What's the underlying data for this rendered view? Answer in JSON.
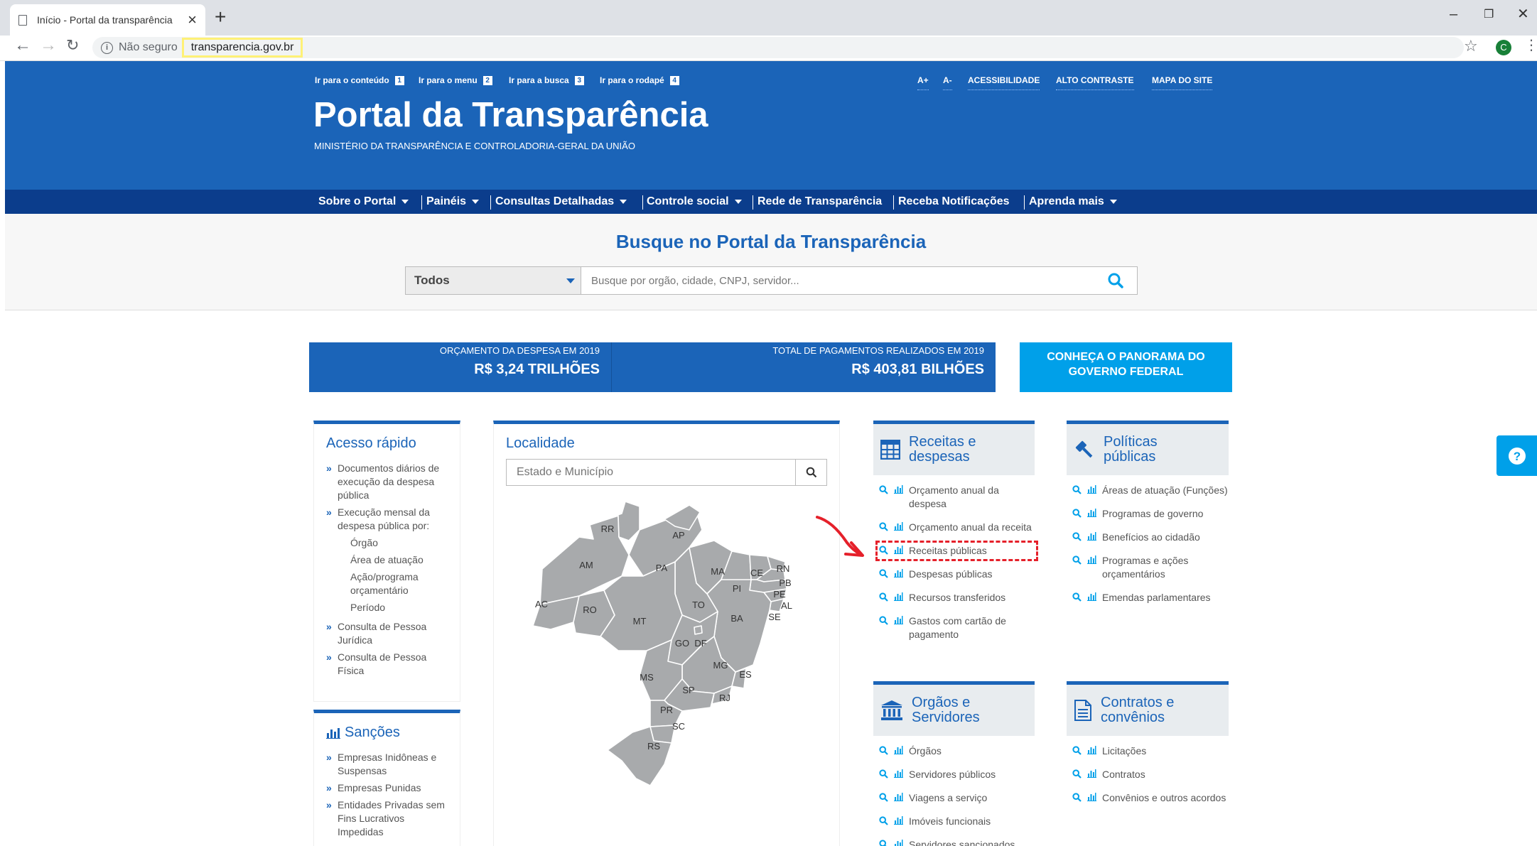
{
  "browser": {
    "tab_title": "Início - Portal da transparência",
    "insecure_label": "Não seguro",
    "url": "transparencia.gov.br",
    "avatar_letter": "C"
  },
  "header": {
    "skip_links": [
      {
        "label": "Ir para o conteúdo",
        "num": "1"
      },
      {
        "label": "Ir para o menu",
        "num": "2"
      },
      {
        "label": "Ir para a busca",
        "num": "3"
      },
      {
        "label": "Ir para o rodapé",
        "num": "4"
      }
    ],
    "font_increase": "A+",
    "font_decrease": "A-",
    "accessibility": "ACESSIBILIDADE",
    "high_contrast": "ALTO CONTRASTE",
    "sitemap": "MAPA DO SITE",
    "title": "Portal da Transparência",
    "subtitle": "MINISTÉRIO DA TRANSPARÊNCIA E CONTROLADORIA-GERAL DA UNIÃO"
  },
  "nav": [
    {
      "label": "Sobre o Portal",
      "dropdown": true
    },
    {
      "label": "Painéis",
      "dropdown": true
    },
    {
      "label": "Consultas Detalhadas",
      "dropdown": true
    },
    {
      "label": "Controle social",
      "dropdown": true
    },
    {
      "label": "Rede de Transparência",
      "dropdown": false
    },
    {
      "label": "Receba Notificações",
      "dropdown": false
    },
    {
      "label": "Aprenda mais",
      "dropdown": true
    }
  ],
  "search": {
    "title": "Busque no Portal da Transparência",
    "scope_selected": "Todos",
    "placeholder": "Busque por orgão, cidade, CNPJ, servidor..."
  },
  "stats": [
    {
      "label": "ORÇAMENTO DA DESPESA EM 2019",
      "value": "R$ 3,24 TRILHÕES"
    },
    {
      "label": "TOTAL DE PAGAMENTOS REALIZADOS EM 2019",
      "value": "R$ 403,81 BILHÕES"
    }
  ],
  "panorama": {
    "line1": "CONHEÇA O PANORAMA DO",
    "line2": "GOVERNO FEDERAL"
  },
  "quick_access": {
    "title": "Acesso rápido",
    "items": [
      {
        "text": "Documentos diários de execução da despesa pública",
        "level": 0
      },
      {
        "text": "Execução mensal da despesa pública por:",
        "level": 0
      },
      {
        "text": "Órgão",
        "level": 1
      },
      {
        "text": "Área de atuação",
        "level": 1
      },
      {
        "text": "Ação/programa orçamentário",
        "level": 1
      },
      {
        "text": "Período",
        "level": 1
      },
      {
        "text": "Consulta de Pessoa Jurídica",
        "level": 0
      },
      {
        "text": "Consulta de Pessoa Física",
        "level": 0
      }
    ]
  },
  "sanctions": {
    "title": "Sanções",
    "items": [
      "Empresas Inidôneas e Suspensas",
      "Empresas Punidas",
      "Entidades Privadas sem Fins Lucrativos Impedidas"
    ]
  },
  "locality": {
    "title": "Localidade",
    "placeholder": "Estado e Município",
    "states": [
      "RR",
      "AP",
      "AM",
      "PA",
      "MA",
      "CE",
      "RN",
      "PB",
      "PE",
      "AL",
      "SE",
      "PI",
      "AC",
      "RO",
      "TO",
      "MT",
      "BA",
      "GO",
      "DF",
      "MG",
      "ES",
      "MS",
      "SP",
      "RJ",
      "PR",
      "SC",
      "RS"
    ]
  },
  "revenue_expenses": {
    "title": "Receitas e despesas",
    "icon": "table-icon",
    "items": [
      "Orçamento anual da despesa",
      "Orçamento anual da receita",
      "Receitas públicas",
      "Despesas públicas",
      "Recursos transferidos",
      "Gastos com cartão de pagamento"
    ],
    "highlighted": "Receitas públicas"
  },
  "public_policies": {
    "title": "Políticas públicas",
    "icon": "gavel-icon",
    "items": [
      "Áreas de atuação (Funções)",
      "Programas de governo",
      "Benefícios ao cidadão",
      "Programas e ações orçamentários",
      "Emendas parlamentares"
    ]
  },
  "agencies": {
    "title": "Orgãos e Servidores",
    "icon": "building-icon",
    "items": [
      "Órgãos",
      "Servidores públicos",
      "Viagens a serviço",
      "Imóveis funcionais",
      "Servidores sancionados"
    ]
  },
  "contracts": {
    "title": "Contratos e convênios",
    "icon": "document-icon",
    "items": [
      "Licitações",
      "Contratos",
      "Convênios e outros acordos"
    ]
  },
  "colors": {
    "primary": "#1b64b8",
    "nav": "#0b3d8c",
    "accent": "#00a0e9",
    "highlight": "#e5202a"
  }
}
